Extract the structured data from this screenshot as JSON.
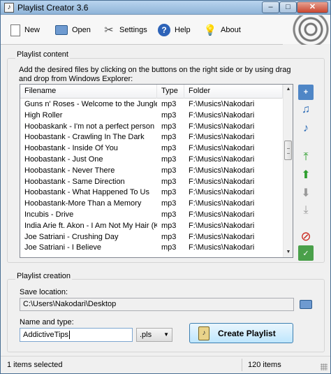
{
  "window": {
    "title": "Playlist Creator 3.6",
    "controls": {
      "minimize": "–",
      "maximize": "□",
      "close": "✕"
    }
  },
  "toolbar": {
    "items": [
      {
        "label": "New",
        "icon": "new-document-icon"
      },
      {
        "label": "Open",
        "icon": "open-folder-icon"
      },
      {
        "label": "Settings",
        "icon": "settings-tools-icon"
      },
      {
        "label": "Help",
        "icon": "help-icon"
      },
      {
        "label": "About",
        "icon": "lightbulb-icon"
      }
    ]
  },
  "playlist_content": {
    "title": "Playlist content",
    "hint": "Add the desired files by clicking on the buttons on the right side or by using drag and drop from Windows Explorer:",
    "columns": [
      "Filename",
      "Type",
      "Folder"
    ],
    "rows": [
      [
        "Guns n' Roses - Welcome to the Jungle",
        "mp3",
        "F:\\Musics\\Nakodari"
      ],
      [
        "High Roller",
        "mp3",
        "F:\\Musics\\Nakodari"
      ],
      [
        "Hoobaskank - I'm not a perfect person",
        "mp3",
        "F:\\Musics\\Nakodari"
      ],
      [
        "Hoobastank - Crawling In The Dark",
        "mp3",
        "F:\\Musics\\Nakodari"
      ],
      [
        "Hoobastank - Inside Of You",
        "mp3",
        "F:\\Musics\\Nakodari"
      ],
      [
        "Hoobastank - Just One",
        "mp3",
        "F:\\Musics\\Nakodari"
      ],
      [
        "Hoobastank - Never There",
        "mp3",
        "F:\\Musics\\Nakodari"
      ],
      [
        "Hoobastank - Same Direction",
        "mp3",
        "F:\\Musics\\Nakodari"
      ],
      [
        "Hoobastank - What Happened To Us",
        "mp3",
        "F:\\Musics\\Nakodari"
      ],
      [
        "Hoobastank-More Than a Memory",
        "mp3",
        "F:\\Musics\\Nakodari"
      ],
      [
        "Incubis - Drive",
        "mp3",
        "F:\\Musics\\Nakodari"
      ],
      [
        "India Arie ft. Akon - I Am Not My Hair (Ko...",
        "mp3",
        "F:\\Musics\\Nakodari"
      ],
      [
        "Joe Satriani - Crushing Day",
        "mp3",
        "F:\\Musics\\Nakodari"
      ],
      [
        "Joe Satriani - I Believe",
        "mp3",
        "F:\\Musics\\Nakodari"
      ]
    ],
    "side_buttons": [
      {
        "name": "add-folder-button",
        "icon": "add-folder-icon",
        "glyph": "+"
      },
      {
        "name": "add-files-button",
        "icon": "add-music-files-icon",
        "glyph": "♫"
      },
      {
        "name": "add-file-button",
        "icon": "add-music-file-icon",
        "glyph": "♪"
      },
      {
        "name": "move-top-button",
        "icon": "move-to-top-icon",
        "glyph": "⤒"
      },
      {
        "name": "move-up-button",
        "icon": "move-up-icon",
        "glyph": "⬆"
      },
      {
        "name": "move-down-button",
        "icon": "move-down-icon",
        "glyph": "⬇"
      },
      {
        "name": "move-bottom-button",
        "icon": "move-to-bottom-icon",
        "glyph": "⤓"
      },
      {
        "name": "remove-button",
        "icon": "remove-icon",
        "glyph": "⊘"
      },
      {
        "name": "clear-button",
        "icon": "clear-list-icon",
        "glyph": "✓"
      }
    ]
  },
  "playlist_creation": {
    "title": "Playlist creation",
    "save_location_label": "Save location:",
    "save_location_value": "C:\\Users\\Nakodari\\Desktop",
    "name_type_label": "Name and type:",
    "name_value": "AddictiveTips",
    "type_value": ".pls",
    "create_button_label": "Create Playlist"
  },
  "status": {
    "selected": "1 items selected",
    "total": "120 items"
  },
  "colors": {
    "accent": "#3c7fb1",
    "titlebar": "#9fc1e2",
    "remove": "#c9241a",
    "move": "#2e9e2e"
  }
}
